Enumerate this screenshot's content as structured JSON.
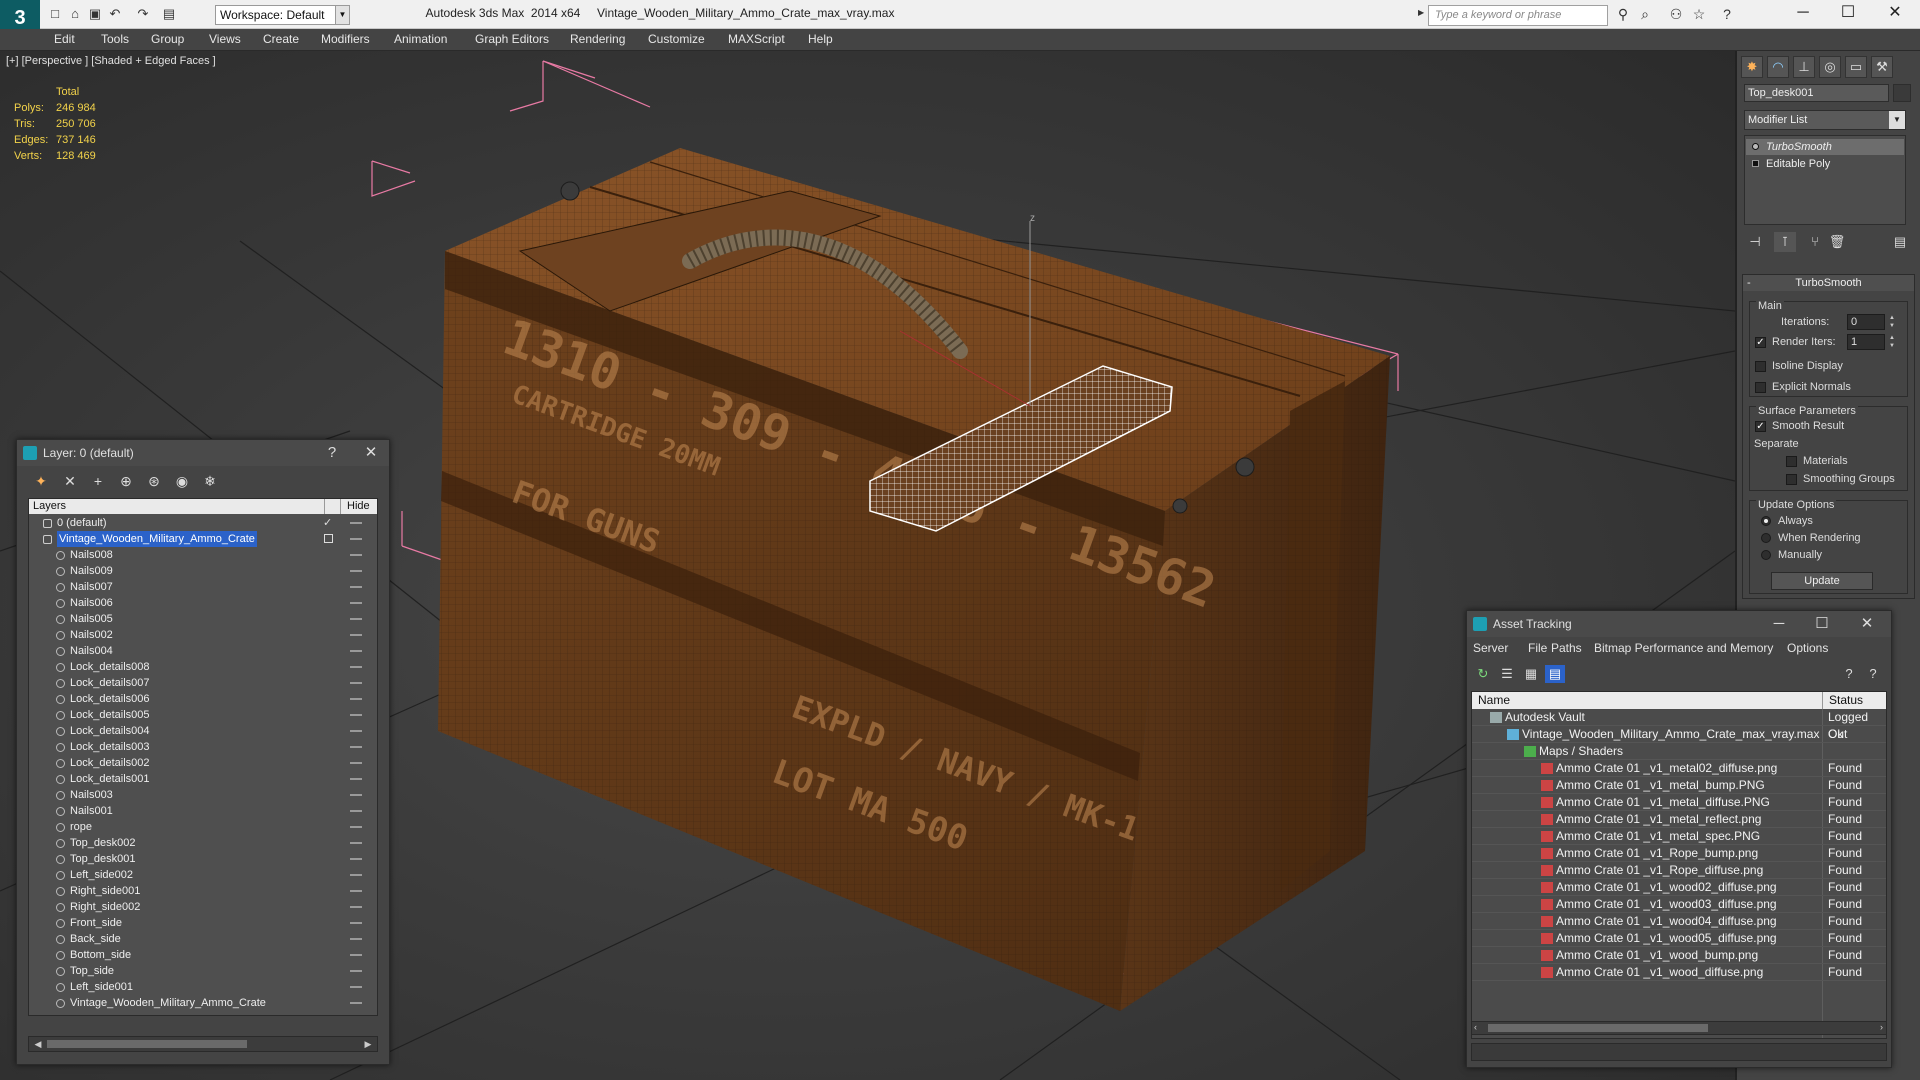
{
  "titlebar": {
    "app_name": "Autodesk 3ds Max  2014 x64",
    "file_name": "Vintage_Wooden_Military_Ammo_Crate_max_vray.max",
    "workspace_label": "Workspace: Default",
    "search_placeholder": "Type a keyword or phrase",
    "icons": [
      "binoculars-icon",
      "search-icon",
      "subscription-icon",
      "favorites-star-icon",
      "help-icon"
    ]
  },
  "menubar": [
    "Edit",
    "Tools",
    "Group",
    "Views",
    "Create",
    "Modifiers",
    "Animation",
    "Graph Editors",
    "Rendering",
    "Customize",
    "MAXScript",
    "Help"
  ],
  "viewport": {
    "label": "[+] [Perspective ] [Shaded + Edged Faces ]",
    "stats_header": "Total",
    "stats": [
      {
        "label": "Polys:",
        "value": "246 984"
      },
      {
        "label": "Tris:",
        "value": "250 706"
      },
      {
        "label": "Edges:",
        "value": "737 146"
      },
      {
        "label": "Verts:",
        "value": "128 469"
      }
    ],
    "gizmo_axis": "z",
    "crate_stencil": [
      "1310 - 309 - 4936 - 13562",
      "CARTRIDGE 20MM",
      "FOR GUNS",
      "EXPLD / NAVY / MK-1",
      "LOT MA 500"
    ]
  },
  "command_panel": {
    "object_name": "Top_desk001",
    "modifier_list": "Modifier List",
    "stack": [
      "TurboSmooth",
      "Editable Poly"
    ],
    "rollout_title": "TurboSmooth",
    "main_group": "Main",
    "iterations_label": "Iterations:",
    "iterations_value": "0",
    "render_iters_label": "Render Iters:",
    "render_iters_value": "1",
    "isoline_label": "Isoline Display",
    "explicit_normals_label": "Explicit Normals",
    "surface_group": "Surface Parameters",
    "smooth_result_label": "Smooth Result",
    "separate_label": "Separate",
    "materials_label": "Materials",
    "smoothing_groups_label": "Smoothing Groups",
    "update_group": "Update Options",
    "always_label": "Always",
    "when_rendering_label": "When Rendering",
    "manually_label": "Manually",
    "update_button": "Update"
  },
  "layer_panel": {
    "title": "Layer: 0 (default)",
    "help": "?",
    "col_layers": "Layers",
    "col_hide": "Hide",
    "rows": [
      {
        "name": "0 (default)",
        "level": 0,
        "kind": "layer"
      },
      {
        "name": "Vintage_Wooden_Military_Ammo_Crate",
        "level": 0,
        "kind": "layer",
        "selected": true
      },
      {
        "name": "Nails008",
        "level": 1,
        "kind": "object"
      },
      {
        "name": "Nails009",
        "level": 1,
        "kind": "object"
      },
      {
        "name": "Nails007",
        "level": 1,
        "kind": "object"
      },
      {
        "name": "Nails006",
        "level": 1,
        "kind": "object"
      },
      {
        "name": "Nails005",
        "level": 1,
        "kind": "object"
      },
      {
        "name": "Nails002",
        "level": 1,
        "kind": "object"
      },
      {
        "name": "Nails004",
        "level": 1,
        "kind": "object"
      },
      {
        "name": "Lock_details008",
        "level": 1,
        "kind": "object"
      },
      {
        "name": "Lock_details007",
        "level": 1,
        "kind": "object"
      },
      {
        "name": "Lock_details006",
        "level": 1,
        "kind": "object"
      },
      {
        "name": "Lock_details005",
        "level": 1,
        "kind": "object"
      },
      {
        "name": "Lock_details004",
        "level": 1,
        "kind": "object"
      },
      {
        "name": "Lock_details003",
        "level": 1,
        "kind": "object"
      },
      {
        "name": "Lock_details002",
        "level": 1,
        "kind": "object"
      },
      {
        "name": "Lock_details001",
        "level": 1,
        "kind": "object"
      },
      {
        "name": "Nails003",
        "level": 1,
        "kind": "object"
      },
      {
        "name": "Nails001",
        "level": 1,
        "kind": "object"
      },
      {
        "name": "rope",
        "level": 1,
        "kind": "object"
      },
      {
        "name": "Top_desk002",
        "level": 1,
        "kind": "object"
      },
      {
        "name": "Top_desk001",
        "level": 1,
        "kind": "object"
      },
      {
        "name": "Left_side002",
        "level": 1,
        "kind": "object"
      },
      {
        "name": "Right_side001",
        "level": 1,
        "kind": "object"
      },
      {
        "name": "Right_side002",
        "level": 1,
        "kind": "object"
      },
      {
        "name": "Front_side",
        "level": 1,
        "kind": "object"
      },
      {
        "name": "Back_side",
        "level": 1,
        "kind": "object"
      },
      {
        "name": "Bottom_side",
        "level": 1,
        "kind": "object"
      },
      {
        "name": "Top_side",
        "level": 1,
        "kind": "object"
      },
      {
        "name": "Left_side001",
        "level": 1,
        "kind": "object"
      },
      {
        "name": "Vintage_Wooden_Military_Ammo_Crate",
        "level": 1,
        "kind": "object"
      }
    ]
  },
  "asset_panel": {
    "title": "Asset Tracking",
    "menu": [
      "Server",
      "File",
      "Paths",
      "Bitmap Performance and Memory",
      "Options"
    ],
    "col_name": "Name",
    "col_status": "Status",
    "rows": [
      {
        "name": "Autodesk Vault",
        "status": "Logged Out",
        "level": 0,
        "kind": "vault"
      },
      {
        "name": "Vintage_Wooden_Military_Ammo_Crate_max_vray.max",
        "status": "Ok",
        "level": 1,
        "kind": "maxfile"
      },
      {
        "name": "Maps / Shaders",
        "status": "",
        "level": 2,
        "kind": "folder"
      },
      {
        "name": "Ammo Crate 01 _v1_metal02_diffuse.png",
        "status": "Found",
        "level": 3,
        "kind": "png"
      },
      {
        "name": "Ammo Crate 01 _v1_metal_bump.PNG",
        "status": "Found",
        "level": 3,
        "kind": "png"
      },
      {
        "name": "Ammo Crate 01 _v1_metal_diffuse.PNG",
        "status": "Found",
        "level": 3,
        "kind": "png"
      },
      {
        "name": "Ammo Crate 01 _v1_metal_reflect.png",
        "status": "Found",
        "level": 3,
        "kind": "png"
      },
      {
        "name": "Ammo Crate 01 _v1_metal_spec.PNG",
        "status": "Found",
        "level": 3,
        "kind": "png"
      },
      {
        "name": "Ammo Crate 01 _v1_Rope_bump.png",
        "status": "Found",
        "level": 3,
        "kind": "png"
      },
      {
        "name": "Ammo Crate 01 _v1_Rope_diffuse.png",
        "status": "Found",
        "level": 3,
        "kind": "png"
      },
      {
        "name": "Ammo Crate 01 _v1_wood02_diffuse.png",
        "status": "Found",
        "level": 3,
        "kind": "png"
      },
      {
        "name": "Ammo Crate 01 _v1_wood03_diffuse.png",
        "status": "Found",
        "level": 3,
        "kind": "png"
      },
      {
        "name": "Ammo Crate 01 _v1_wood04_diffuse.png",
        "status": "Found",
        "level": 3,
        "kind": "png"
      },
      {
        "name": "Ammo Crate 01 _v1_wood05_diffuse.png",
        "status": "Found",
        "level": 3,
        "kind": "png"
      },
      {
        "name": "Ammo Crate 01 _v1_wood_bump.png",
        "status": "Found",
        "level": 3,
        "kind": "png"
      },
      {
        "name": "Ammo Crate 01 _v1_wood_diffuse.png",
        "status": "Found",
        "level": 3,
        "kind": "png"
      }
    ]
  },
  "colors": {
    "selection_blue": "#2b62c9",
    "stats_yellow": "#f2d24a",
    "bbox_pink": "#e87aa4",
    "wood_brown": "#7a4a22"
  }
}
